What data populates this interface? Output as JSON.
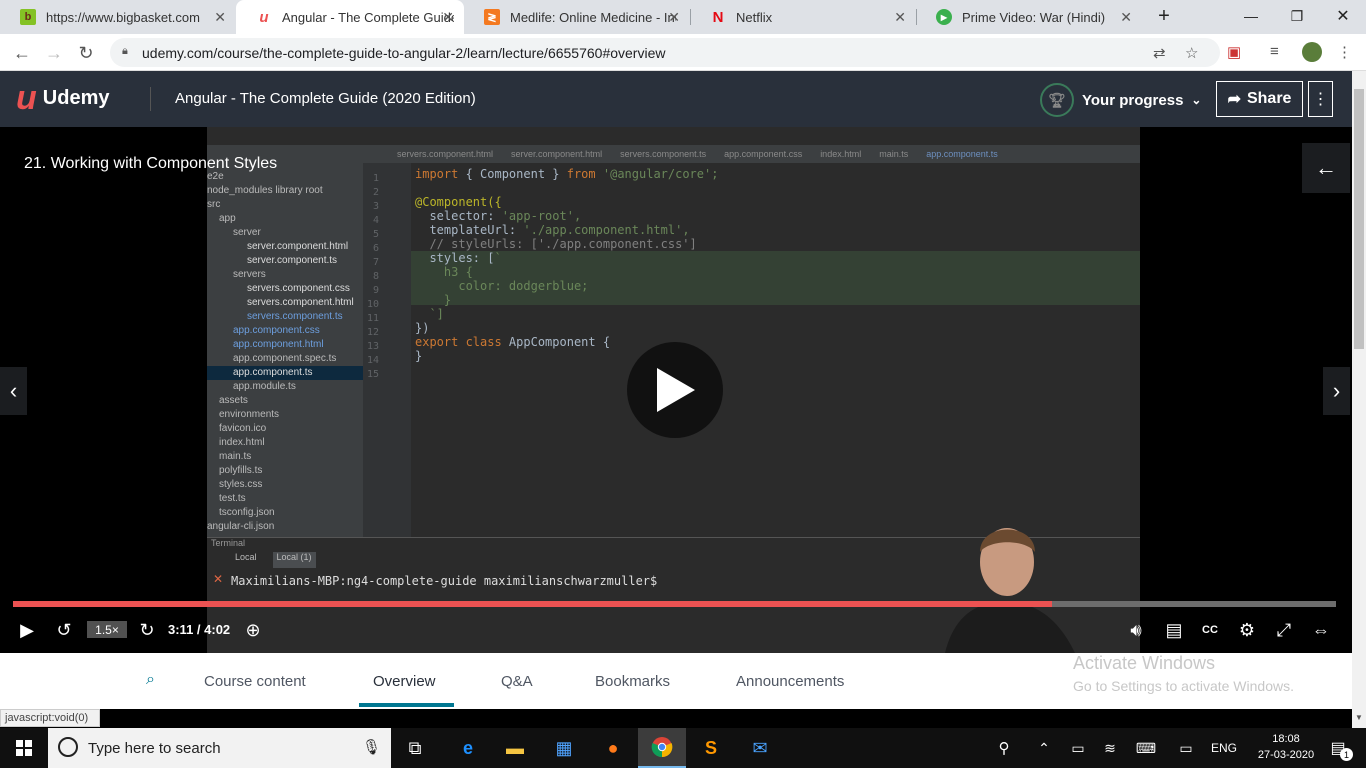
{
  "browser": {
    "tabs": [
      {
        "title": "https://www.bigbasket.com",
        "icon": "bigbasket-icon",
        "fav": "bb",
        "color": "#84c225"
      },
      {
        "title": "Angular - The Complete Guide",
        "icon": "udemy-icon",
        "fav": "u",
        "color": "#ec5252"
      },
      {
        "title": "Medlife: Online Medicine - Ind",
        "icon": "medlife-icon",
        "fav": "≷",
        "color": "#f47920"
      },
      {
        "title": "Netflix",
        "icon": "netflix-icon",
        "fav": "N",
        "color": "#e50914"
      },
      {
        "title": "Prime Video: War (Hindi)",
        "icon": "prime-video-icon",
        "fav": "▶",
        "color": "#3bb04e"
      }
    ],
    "url": "udemy.com/course/the-complete-guide-to-angular-2/learn/lecture/6655760#overview"
  },
  "header": {
    "logo": "Udemy",
    "course_title": "Angular - The Complete Guide (2020 Edition)",
    "progress_label": "Your progress",
    "share_label": "Share"
  },
  "video": {
    "lesson_title": "21. Working with Component Styles",
    "ide": {
      "tabs": [
        "servers.component.html",
        "server.component.html",
        "servers.component.ts",
        "app.component.css",
        "index.html",
        "main.ts",
        "app.component.ts"
      ],
      "project_items": [
        "e2e",
        "node_modules  library root",
        "src",
        "app",
        "server",
        "server.component.html",
        "server.component.ts",
        "servers",
        "servers.component.css",
        "servers.component.html",
        "servers.component.ts",
        "app.component.css",
        "app.component.html",
        "app.component.spec.ts",
        "app.component.ts",
        "app.module.ts",
        "assets",
        "environments",
        "favicon.ico",
        "index.html",
        "main.ts",
        "polyfills.ts",
        "styles.css",
        "test.ts",
        "tsconfig.json",
        "angular-cli.json"
      ],
      "line_numbers": [
        "1",
        "2",
        "3",
        "4",
        "5",
        "6",
        "7",
        "8",
        "9",
        "10",
        "11",
        "12",
        "13",
        "14",
        "15"
      ],
      "code": {
        "l1_kw": "import",
        "l1_mid": " { Component } ",
        "l1_kw2": "from",
        "l1_str": " '@angular/core';",
        "l3": "@Component({",
        "l4_a": "  selector: ",
        "l4_s": "'app-root',",
        "l5_a": "  templateUrl: ",
        "l5_s": "'./app.component.html',",
        "l6": "  // styleUrls: ['./app.component.css']",
        "l7_a": "  styles: [",
        "l7_s": "`",
        "l8": "    h3 {",
        "l9": "      color: dodgerblue;",
        "l10": "    }",
        "l11": "  `]",
        "l12": "})",
        "l13_kw": "export class",
        "l13_rest": " AppComponent {",
        "l14": "}"
      },
      "terminal_label": "Terminal",
      "terminal_tabs": [
        "Local",
        "Local (1)"
      ],
      "terminal_prompt": "Maximilians-MBP:ng4-complete-guide maximilianschwarzmuller$"
    },
    "playback": {
      "rate": "1.5×",
      "time": "3:11 / 4:02",
      "progress_fraction": 0.785
    }
  },
  "course_tabs": [
    "Course content",
    "Overview",
    "Q&A",
    "Bookmarks",
    "Announcements"
  ],
  "active_course_tab": "Overview",
  "watermark": {
    "title": "Activate Windows",
    "subtitle": "Go to Settings to activate Windows."
  },
  "status_bar": "javascript:void(0)",
  "taskbar": {
    "search_placeholder": "Type here to search",
    "lang": "ENG",
    "time": "18:08",
    "date": "27-03-2020",
    "notifications": "1"
  }
}
